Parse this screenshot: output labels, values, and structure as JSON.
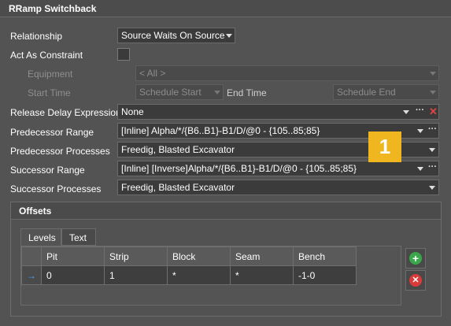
{
  "window": {
    "title": "RRamp Switchback"
  },
  "relationship": {
    "label": "Relationship",
    "value": "Source Waits On Source"
  },
  "act_as_constraint": {
    "label": "Act As Constraint",
    "checked": false
  },
  "equipment": {
    "label": "Equipment",
    "value": "< All >"
  },
  "start_time": {
    "label": "Start Time",
    "value": "Schedule Start"
  },
  "end_time": {
    "label": "End Time",
    "value": "Schedule End"
  },
  "release_delay": {
    "label": "Release Delay Expression",
    "value": "None"
  },
  "predecessor_range": {
    "label": "Predecessor Range",
    "value": "[Inline] Alpha/*/{B6..B1}-B1/D/@0 - {105..85;85}"
  },
  "predecessor_processes": {
    "label": "Predecessor Processes",
    "value": "Freedig, Blasted Excavator"
  },
  "successor_range": {
    "label": "Successor Range",
    "value": "[Inline]  [Inverse]Alpha/*/{B6..B1}-B1/D/@0 - {105..85;85}"
  },
  "successor_processes": {
    "label": "Successor Processes",
    "value": "Freedig, Blasted Excavator"
  },
  "badge": {
    "text": "1",
    "color": "#f0b61f"
  },
  "offsets": {
    "title": "Offsets",
    "tabs": [
      {
        "label": "Levels",
        "active": true
      },
      {
        "label": "Text",
        "active": false
      }
    ],
    "columns": [
      "Pit",
      "Strip",
      "Block",
      "Seam",
      "Bench"
    ],
    "rows": [
      {
        "indicator": "→",
        "cells": [
          "0",
          "1",
          "*",
          "*",
          "-1-0"
        ]
      }
    ],
    "add_icon": "plus-circle-icon",
    "remove_icon": "x-circle-icon"
  },
  "colors": {
    "add": "#3aa84a",
    "remove": "#d93a3a",
    "row_indicator": "#4ea3ff"
  }
}
